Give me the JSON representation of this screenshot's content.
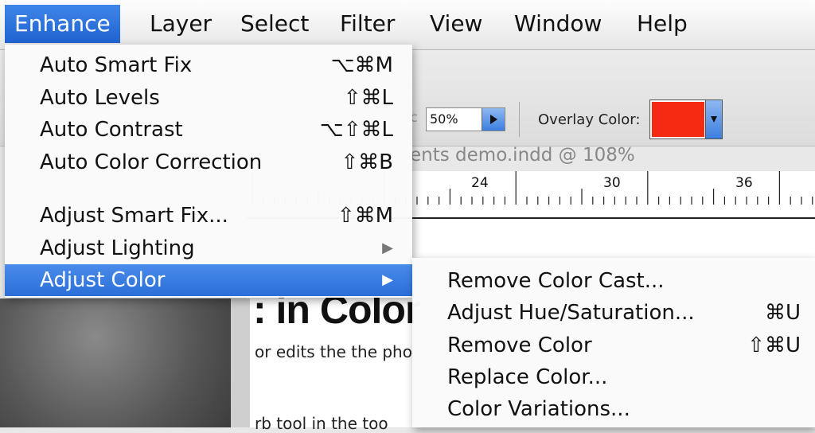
{
  "menubar": {
    "items": [
      "Enhance",
      "Layer",
      "Select",
      "Filter",
      "View",
      "Window",
      "Help"
    ]
  },
  "enhance_menu": {
    "items": [
      {
        "label": "Auto Smart Fix",
        "shortcut": "⌥⌘M"
      },
      {
        "label": "Auto Levels",
        "shortcut": "⇧⌘L"
      },
      {
        "label": "Auto Contrast",
        "shortcut": "⌥⇧⌘L"
      },
      {
        "label": "Auto Color Correction",
        "shortcut": "⇧⌘B"
      },
      {
        "label": "Adjust Smart Fix...",
        "shortcut": "⇧⌘M"
      },
      {
        "label": "Adjust Lighting",
        "submenu": true
      },
      {
        "label": "Adjust Color",
        "submenu": true,
        "highlighted": true
      }
    ]
  },
  "adjust_color_submenu": {
    "items": [
      {
        "label": "Remove Color Cast...",
        "shortcut": ""
      },
      {
        "label": "Adjust Hue/Saturation...",
        "shortcut": "⌘U"
      },
      {
        "label": "Remove Color",
        "shortcut": "⇧⌘U"
      },
      {
        "label": "Replace Color...",
        "shortcut": ""
      },
      {
        "label": "Color Variations...",
        "shortcut": ""
      }
    ]
  },
  "toolbar": {
    "opacity_label_fragment": "ac",
    "opacity_value": "50%",
    "overlay_label": "Overlay Color:",
    "overlay_color": "#f42a12"
  },
  "document": {
    "title_fragment": "ents demo.indd @ 108%",
    "ruler_marks": [
      "24",
      "30",
      "36"
    ],
    "heading_fragment": ": in Color",
    "text_line_1": "or edits the the pho",
    "text_line_2": "rb tool in the too"
  },
  "colors": {
    "menu_highlight": "#2a6ed9",
    "menubar_active": "#2f73de"
  }
}
